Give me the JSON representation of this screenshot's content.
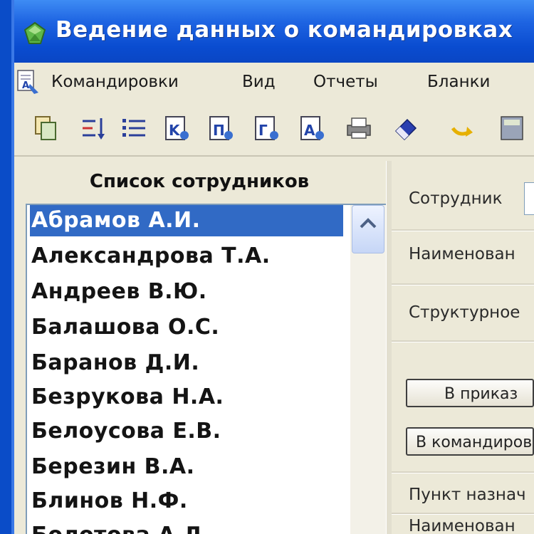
{
  "window": {
    "title": "Ведение данных о командировках",
    "icon": "gem-icon",
    "accent": "#0A4CD0"
  },
  "menu": {
    "icon": "document-icon",
    "items": [
      {
        "label": "Командировки"
      },
      {
        "label": "Вид"
      },
      {
        "label": "Отчеты"
      },
      {
        "label": "Бланки"
      }
    ]
  },
  "toolbar": {
    "buttons": [
      "copy-icon",
      "sort-icon",
      "list-icon",
      "report-k-icon",
      "report-p-icon",
      "report-g-icon",
      "report-a-icon",
      "print-icon",
      "eraser-icon",
      "arrow-icon",
      "calculator-icon"
    ]
  },
  "employees": {
    "header": "Список сотрудников",
    "selected_index": 0,
    "items": [
      "Абрамов А.И.",
      "Александрова Т.А.",
      "Андреев В.Ю.",
      "Балашова О.С.",
      "Баранов Д.И.",
      "Безрукова Н.А.",
      "Белоусова Е.В.",
      "Березин В.А.",
      "Блинов Н.Ф.",
      "Болотова А.Д."
    ]
  },
  "details": {
    "employee_label": "Сотрудник",
    "name_label": "Наименован",
    "structure_label": "Структурное",
    "order_button": "В приказ",
    "trip_button": "В командиров",
    "destination_label": "Пункт назнач",
    "org_label": "Наименован"
  }
}
